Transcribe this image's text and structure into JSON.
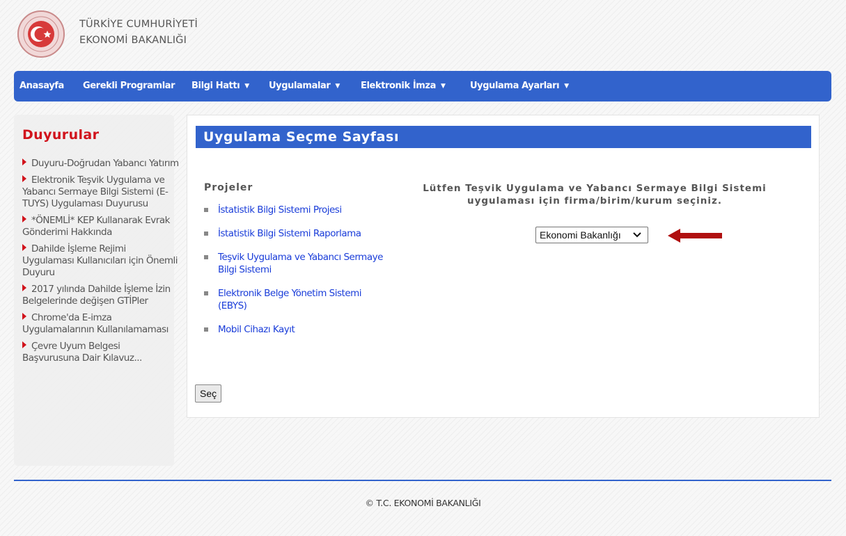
{
  "header": {
    "line1": "TÜRKİYE CUMHURİYETİ",
    "line2": "EKONOMİ BAKANLIĞI"
  },
  "nav": {
    "items": [
      {
        "label": "Anasayfa"
      },
      {
        "label": "Gerekli Programlar"
      },
      {
        "label": "Bilgi Hattı",
        "caret": "▼"
      },
      {
        "label": "Uygulamalar",
        "caret": "▼"
      },
      {
        "label": "Elektronik İmza",
        "caret": "▼"
      },
      {
        "label": "Uygulama Ayarları",
        "caret": "▼"
      }
    ]
  },
  "sidebar": {
    "title": "Duyurular",
    "items": [
      {
        "label": "Duyuru-Doğrudan Yabancı Yatırım"
      },
      {
        "label": "Elektronik Teşvik Uygulama ve Yabancı Sermaye Bilgi Sistemi (E-TUYS) Uygulaması Duyurusu"
      },
      {
        "label": "*ÖNEMLİ* KEP Kullanarak Evrak Gönderimi Hakkında"
      },
      {
        "label": "Dahilde İşleme Rejimi Uygulaması Kullanıcıları için Önemli Duyuru"
      },
      {
        "label": "2017 yılında Dahilde İşleme İzin Belgelerinde değişen GTİPler"
      },
      {
        "label": "Chrome'da E-imza Uygulamalarının Kullanılamaması"
      },
      {
        "label": "Çevre Uyum Belgesi Başvurusuna Dair Kılavuz..."
      }
    ]
  },
  "main": {
    "title": "Uygulama Seçme Sayfası",
    "projects_title": "Projeler",
    "projects": [
      {
        "label": "İstatistik Bilgi Sistemi Projesi"
      },
      {
        "label": "İstatistik Bilgi Sistemi Raporlama"
      },
      {
        "label": "Teşvik Uygulama ve Yabancı Sermaye Bilgi Sistemi"
      },
      {
        "label": "Elektronik Belge Yönetim Sistemi (EBYS)"
      },
      {
        "label": "Mobil Cihazı Kayıt"
      }
    ],
    "prompt": "Lütfen Teşvik Uygulama ve Yabancı Sermaye Bilgi Sistemi uygulaması için firma/birim/kurum seçiniz.",
    "select_value": "Ekonomi Bakanlığı",
    "submit_label": "Seç"
  },
  "footer": {
    "text": "© T.C. EKONOMİ BAKANLIĞI"
  },
  "colors": {
    "primary_blue": "#3263cc",
    "accent_red": "#d1131c",
    "arrow_red": "#b01010",
    "link_blue": "#1a3dd9"
  },
  "icons": {
    "logo": "ministry-seal-logo",
    "dropdown": "chevron-down-icon",
    "pointer": "arrow-left-icon",
    "nav_caret": "caret-down-icon",
    "list_marker": "triangle-right-icon"
  }
}
